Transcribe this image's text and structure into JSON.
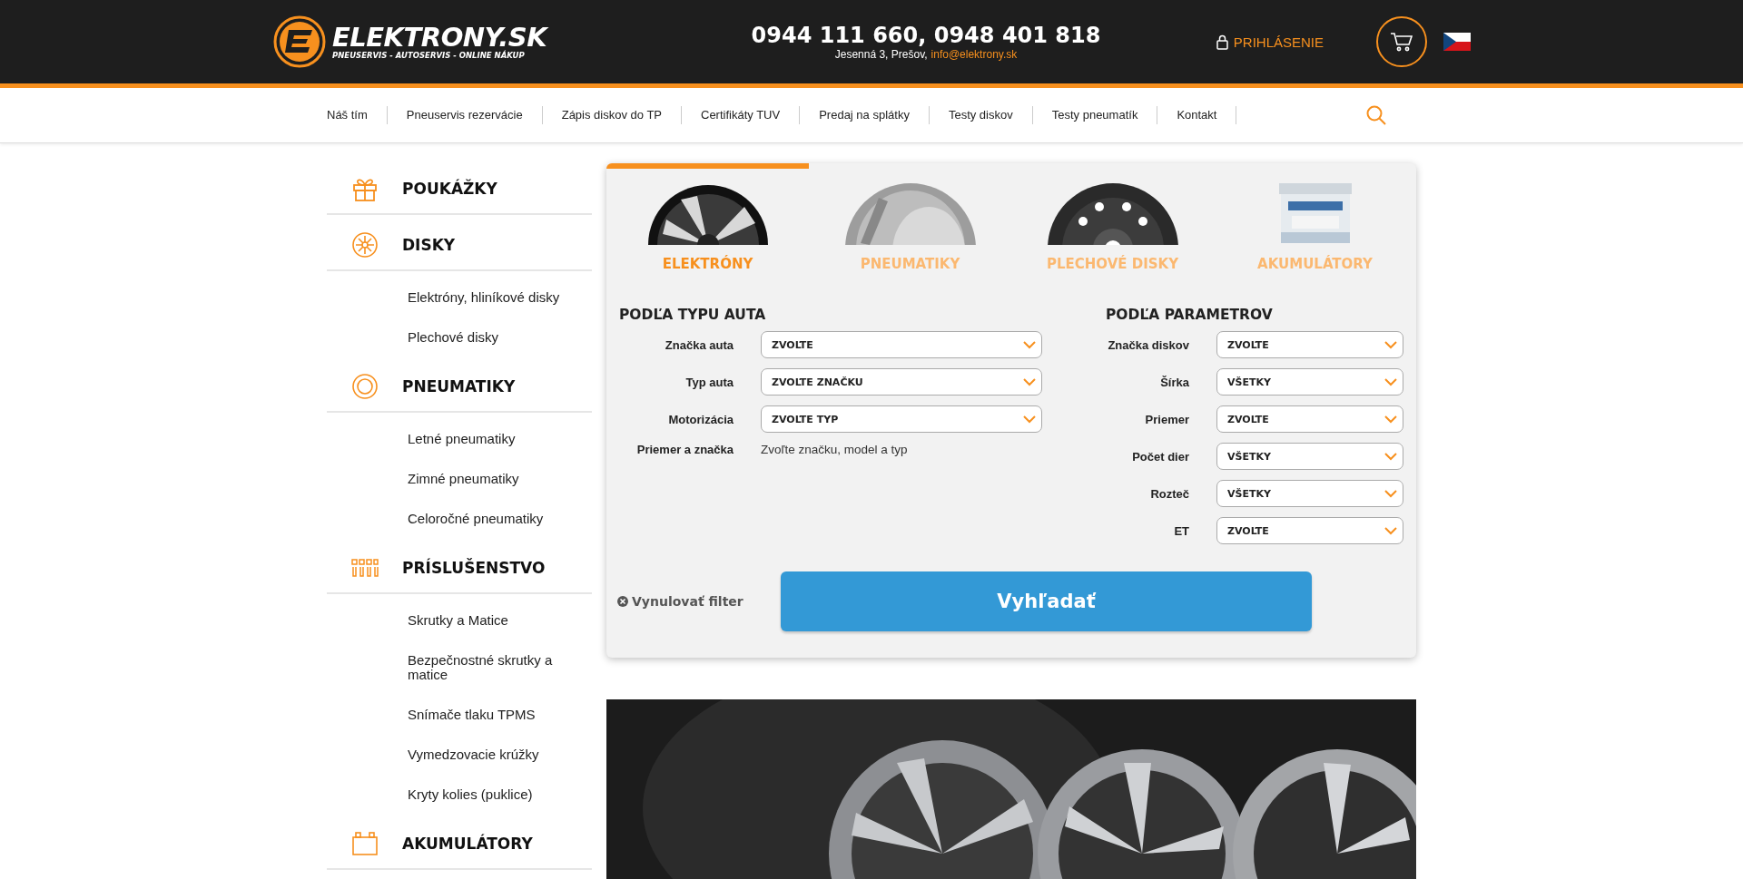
{
  "header": {
    "brand": "ELEKTRONY.SK",
    "tagline": "PNEUSERVIS - AUTOSERVIS - ONLINE NÁKUP",
    "phones": "0944 111 660, 0948 401 818",
    "address": "Jesenná 3, Prešov,",
    "email": "info@elektrony.sk",
    "login": "PRIHLÁSENIE"
  },
  "nav": [
    "Náš tím",
    "Pneuservis rezervácie",
    "Zápis diskov do TP",
    "Certifikáty TUV",
    "Predaj na splátky",
    "Testy diskov",
    "Testy pneumatík",
    "Kontakt"
  ],
  "sidebar": [
    {
      "title": "POUKÁŽKY",
      "kind": "gift"
    },
    {
      "title": "DISKY",
      "kind": "wheel",
      "children": [
        "Elektróny, hliníkové disky",
        "Plechové disky"
      ]
    },
    {
      "title": "PNEUMATIKY",
      "kind": "tire",
      "children": [
        "Letné pneumatiky",
        "Zimné pneumatiky",
        "Celoročné pneumatiky"
      ]
    },
    {
      "title": "PRÍSLUŠENSTVO",
      "kind": "bolts",
      "children": [
        "Skrutky a Matice",
        "Bezpečnostné skrutky a matice",
        "Snímače tlaku TPMS",
        "Vymedzovacie krúžky",
        "Kryty kolies (puklice)"
      ]
    },
    {
      "title": "AKUMULÁTORY",
      "kind": "battery"
    }
  ],
  "filter": {
    "tabs": [
      {
        "label": "ELEKTRÓNY",
        "kind": "alloy",
        "selected": true
      },
      {
        "label": "PNEUMATIKY",
        "kind": "tire",
        "selected": false
      },
      {
        "label": "PLECHOVÉ DISKY",
        "kind": "steel",
        "selected": false
      },
      {
        "label": "AKUMULÁTORY",
        "kind": "battery",
        "selected": false
      }
    ],
    "by_car": {
      "title": "PODĽA TYPU AUTA",
      "fields": [
        {
          "label": "Značka auta",
          "value": "ZVOĽTE"
        },
        {
          "label": "Typ auta",
          "value": "ZVOĽTE ZNAČKU"
        },
        {
          "label": "Motorizácia",
          "value": "ZVOĽTE TYP"
        }
      ],
      "note": {
        "label": "Priemer a značka",
        "text": "Zvoľte značku, model a typ"
      }
    },
    "by_params": {
      "title": "PODĽA PARAMETROV",
      "fields": [
        {
          "label": "Značka diskov",
          "value": "ZVOĽTE"
        },
        {
          "label": "Šírka",
          "value": "VŠETKY"
        },
        {
          "label": "Priemer",
          "value": "ZVOĽTE"
        },
        {
          "label": "Počet dier",
          "value": "VŠETKY"
        },
        {
          "label": "Rozteč",
          "value": "VŠETKY"
        },
        {
          "label": "ET",
          "value": "ZVOĽTE"
        }
      ]
    },
    "reset": "Vynulovať filter",
    "search": "Vyhľadať"
  }
}
